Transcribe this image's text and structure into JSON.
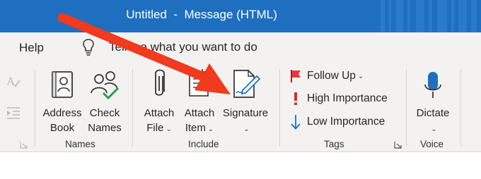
{
  "window": {
    "title": "Untitled  -  Message (HTML)",
    "title_color": "#1e6fc0"
  },
  "menu": {
    "help": "Help",
    "tell_me": "Tell me what you want to do"
  },
  "ribbon": {
    "names_group": {
      "label": "Names",
      "address_book": [
        "Address",
        "Book"
      ],
      "check_names": [
        "Check",
        "Names"
      ]
    },
    "include_group": {
      "label": "Include",
      "attach_file": [
        "Attach",
        "File"
      ],
      "attach_item": [
        "Attach",
        "Item"
      ],
      "signature": "Signature"
    },
    "tags_group": {
      "label": "Tags",
      "follow_up": "Follow Up",
      "high_importance": "High Importance",
      "low_importance": "Low Importance"
    },
    "voice_group": {
      "label": "Voice",
      "dictate": "Dictate"
    }
  },
  "annotation": {
    "arrow_color": "#f23a1e"
  }
}
